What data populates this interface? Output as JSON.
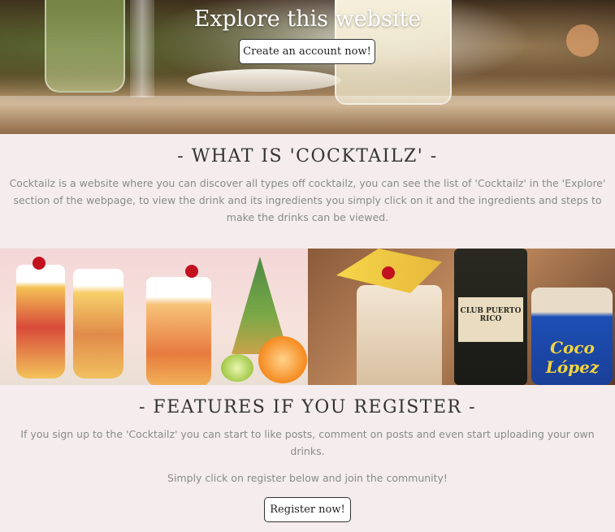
{
  "hero": {
    "title": "Explore this website",
    "button_label": "Create an account now!"
  },
  "what_is": {
    "title": "- WHAT IS 'COCKTAILZ' -",
    "paragraph": "Cocktailz is a website where you can discover all types off cocktailz, you can see the list of 'Cocktailz' in the 'Explore' section of the webpage, to view the drink and its ingredients you simply click on it and the ingredients and steps to make the drinks can be viewed."
  },
  "images": {
    "right_can_text": "Coco López",
    "right_bottle_text": "CLUB PUERTO RICO"
  },
  "features": {
    "title": "- FEATURES IF YOU REGISTER -",
    "paragraph": "If you sign up to the 'Cocktailz' you can start to like posts, comment on posts and even start uploading your own drinks.",
    "cta_text": "Simply click on register below and join the community!",
    "button_label": "Register now!"
  },
  "colors": {
    "page_background": "#f4eced",
    "title_color": "#333333",
    "text_color": "#8a8a8a"
  }
}
